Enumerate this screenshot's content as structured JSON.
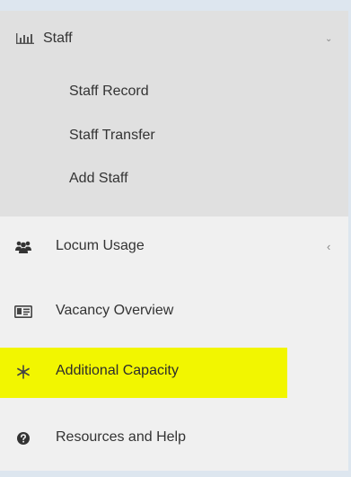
{
  "colors": {
    "page_background": "#dde6ef",
    "menu_background": "#f0f0f0",
    "submenu_background": "#e0e0e0",
    "text": "#333333",
    "highlight": "#f2f600"
  },
  "sidebar": {
    "group": {
      "label": "Staff",
      "icon": "bar-chart-icon",
      "state": "expanded",
      "children": [
        {
          "label": "Staff Record"
        },
        {
          "label": "Staff Transfer"
        },
        {
          "label": "Add Staff"
        }
      ]
    },
    "items": [
      {
        "label": "Locum Usage",
        "icon": "users-icon",
        "has_submenu": true
      },
      {
        "label": "Vacancy Overview",
        "icon": "id-card-icon",
        "has_submenu": false
      },
      {
        "label": "Additional Capacity",
        "icon": "snowflake-icon",
        "has_submenu": false,
        "highlighted": true
      },
      {
        "label": "Resources and Help",
        "icon": "question-circle-icon",
        "has_submenu": false
      }
    ]
  }
}
